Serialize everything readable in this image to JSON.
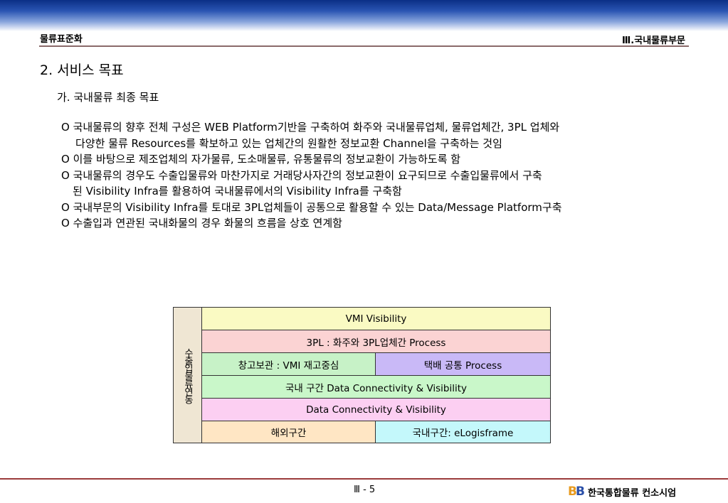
{
  "header": {
    "left": "물류표준화",
    "right": "Ⅲ.국내물류부문"
  },
  "section_title": "2. 서비스 목표",
  "subsection_title": "가. 국내물류 최종 목표",
  "bullets": [
    {
      "lines": [
        "O 국내물류의 향후 전체 구성은 WEB Platform기반을 구축하여 화주와 국내물류업체, 물류업체간, 3PL 업체와",
        "다양한 물류 Resources를 확보하고 있는 업체간의 원활한 정보교환 Channel을 구축하는 것임"
      ]
    },
    {
      "lines": [
        "O 이를 바탕으로 제조업체의 자가물류, 도소매물류, 유통물류의 정보교환이 가능하도록 함"
      ]
    },
    {
      "lines": [
        "O 국내물류의 경우도 수출입물류와 마찬가지로 거래당사자간의 정보교환이 요구되므로 수출입물류에서 구축",
        "된 Visibility Infra를 활용하여 국내물류에서의 Visibility Infra를 구축함"
      ]
    },
    {
      "lines": [
        "O 국내부문의 Visibility Infra를 토대로 3PL업체들이 공통으로 활용할 수 있는 Data/Message Platform구축"
      ]
    },
    {
      "lines": [
        "O 수출입과 연관된 국내화물의 경우 화물의 흐름을 상호 연계함"
      ]
    }
  ],
  "diagram": {
    "side_label": "수출입물류연동",
    "rows": [
      {
        "cells": [
          {
            "text": "VMI Visibility",
            "color": "#fafac3"
          }
        ]
      },
      {
        "cells": [
          {
            "text": "3PL : 화주와 3PL업체간 Process",
            "color": "#fbd3d3"
          }
        ]
      },
      {
        "cells": [
          {
            "text": "창고보관 : VMI 재고중심",
            "color": "#c7f2c7"
          },
          {
            "text": "택배 공통 Process",
            "color": "#c9b9f7"
          }
        ]
      },
      {
        "cells": [
          {
            "text": "국내 구간 Data Connectivity & Visibility",
            "color": "#c9f7c9"
          }
        ]
      },
      {
        "cells": [
          {
            "text": "Data Connectivity & Visibility",
            "color": "#fccff2"
          }
        ]
      },
      {
        "cells": [
          {
            "text": "해외구간",
            "color": "#ffe6c4"
          },
          {
            "text": "국내구간: eLogisframe",
            "color": "#c4f8fb"
          }
        ]
      }
    ]
  },
  "footer": {
    "page": "Ⅲ - 5",
    "logo_mark_a": "B",
    "logo_mark_b": "B",
    "company": "한국통합물류 컨소시엄"
  }
}
